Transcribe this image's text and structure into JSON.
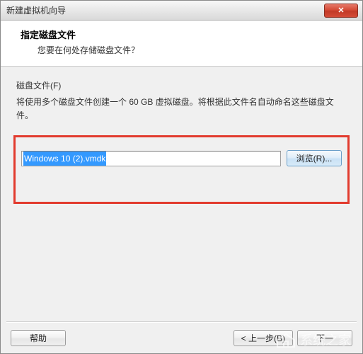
{
  "window": {
    "title": "新建虚拟机向导",
    "close_glyph": "✕"
  },
  "header": {
    "title": "指定磁盘文件",
    "subtitle": "您要在何处存储磁盘文件？"
  },
  "section": {
    "label": "磁盘文件(F)",
    "desc": "将使用多个磁盘文件创建一个 60 GB 虚拟磁盘。将根据此文件名自动命名这些磁盘文件。"
  },
  "file": {
    "value": "Windows 10 (2).vmdk",
    "browse_label": "浏览(R)..."
  },
  "footer": {
    "help": "帮助",
    "back": "< 上一步(B)",
    "next": "下一",
    "cancel": ""
  },
  "watermark": {
    "text": "系统之家"
  }
}
